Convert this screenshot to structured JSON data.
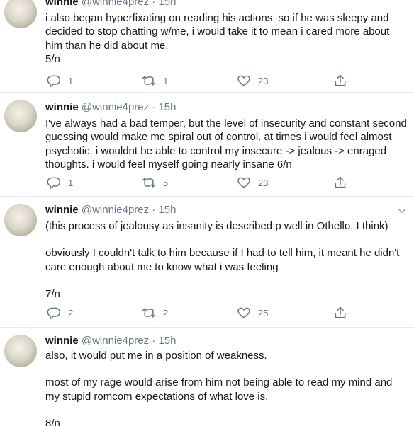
{
  "author": {
    "name": "winnie",
    "handle": "@winnie4prez",
    "separator": "·",
    "time": "15h"
  },
  "icons": {
    "reply": "reply-icon",
    "retweet": "retweet-icon",
    "like": "heart-icon",
    "share": "share-icon",
    "more": "chevron-down-icon",
    "accent": "#657786"
  },
  "tweets": [
    {
      "lines": [
        "i also began hyperfixating on reading his actions. so if he was sleepy and decided to stop chatting w/me, i would take it to mean i cared more about him than he did about me.",
        "5/n"
      ],
      "replies": "1",
      "retweets": "1",
      "likes": "23"
    },
    {
      "lines": [
        "I've always had a bad temper, but the level of insecurity and constant second guessing would make me spiral out of control. at times i would feel almost psychotic. i wouldnt be able to control my insecure -> jealous -> enraged thoughts. i would feel myself going nearly insane 6/n"
      ],
      "replies": "1",
      "retweets": "5",
      "likes": "23"
    },
    {
      "lines": [
        "(this process of jealousy as insanity is described p well in Othello, I think)",
        "",
        "obviously I couldn't talk to him because if I had to tell him, it meant he didn't care enough about me to know what i was feeling",
        "",
        "7/n"
      ],
      "replies": "2",
      "retweets": "2",
      "likes": "25"
    },
    {
      "lines": [
        "also, it would put me in a position of weakness.",
        "",
        "most of my rage would arise from him not being able to read my mind and my stupid romcom expectations of what love is.",
        "",
        "8/n"
      ]
    }
  ]
}
